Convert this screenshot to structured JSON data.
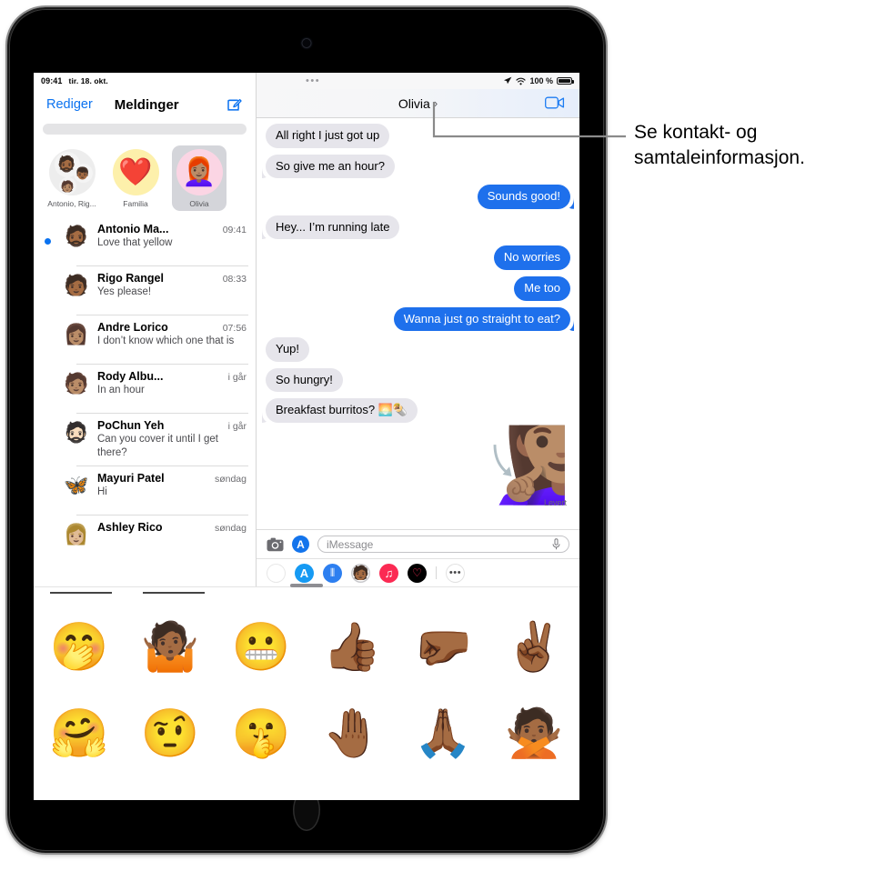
{
  "device": {
    "name": "iPad"
  },
  "status_bar": {
    "time": "09:41",
    "date": "tir. 18. okt.",
    "location_icon": "location-arrow-icon",
    "wifi_icon": "wifi-icon",
    "battery_percent": "100 %",
    "battery_icon": "battery-full-icon",
    "handle_dots": "•••"
  },
  "sidebar": {
    "edit_label": "Rediger",
    "title": "Meldinger",
    "compose_icon": "compose-icon",
    "search_placeholder": "",
    "pinned": [
      {
        "label": "Antonio, Rig...",
        "kind": "group",
        "faces": [
          "🧔🏾",
          "👦🏾",
          "🧑🏽"
        ]
      },
      {
        "label": "Familia",
        "kind": "emoji",
        "glyph": "❤️"
      },
      {
        "label": "Olivia",
        "kind": "memoji",
        "glyph": "👩🏽‍🦰",
        "selected": true
      }
    ],
    "conversations": [
      {
        "name": "Antonio Ma...",
        "time": "09:41",
        "preview": "Love that yellow",
        "unread": true,
        "avatar": "🧔🏾"
      },
      {
        "name": "Rigo Rangel",
        "time": "08:33",
        "preview": "Yes please!",
        "unread": false,
        "avatar": "🧑🏾"
      },
      {
        "name": "Andre Lorico",
        "time": "07:56",
        "preview": "I don’t know which one that is",
        "unread": false,
        "avatar": "👩🏽"
      },
      {
        "name": "Rody Albu...",
        "time": "i går",
        "preview": "In an hour",
        "unread": false,
        "avatar": "🧑🏽"
      },
      {
        "name": "PoChun Yeh",
        "time": "i går",
        "preview": "Can you cover it until I get there?",
        "unread": false,
        "avatar": "🧔🏻"
      },
      {
        "name": "Mayuri Patel",
        "time": "søndag",
        "preview": "Hi",
        "unread": false,
        "avatar": "🦋"
      },
      {
        "name": "Ashley Rico",
        "time": "søndag",
        "preview": "",
        "unread": false,
        "avatar": "👩🏼"
      }
    ]
  },
  "chat": {
    "title": "Olivia",
    "title_chevron": "chevron-right-icon",
    "facetime_icon": "facetime-video-icon",
    "messages": [
      {
        "from": "them",
        "text": "All right I just got up"
      },
      {
        "from": "them",
        "text": "So give me an hour?",
        "tail": true
      },
      {
        "from": "me",
        "text": "Sounds good!",
        "tail": true
      },
      {
        "from": "them",
        "text": "Hey... I’m running late",
        "tail": true
      },
      {
        "from": "me",
        "text": "No worries"
      },
      {
        "from": "me",
        "text": "Me too"
      },
      {
        "from": "me",
        "text": "Wanna just go straight to eat?",
        "tail": true
      },
      {
        "from": "them",
        "text": "Yup!"
      },
      {
        "from": "them",
        "text": "So hungry!"
      },
      {
        "from": "them",
        "text": "Breakfast burritos? 🌅🌯",
        "tail": true
      }
    ],
    "sticker_message": {
      "glyph": "🧏🏽‍♀️",
      "status": "Levert"
    },
    "input": {
      "camera_icon": "camera-icon",
      "appstore_icon": "app-store-icon",
      "placeholder": "iMessage",
      "value": "",
      "mic_icon": "microphone-icon"
    },
    "app_drawer": [
      {
        "name": "photos-app-icon",
        "glyph": "❀"
      },
      {
        "name": "app-store-app-icon",
        "glyph": "A"
      },
      {
        "name": "audio-message-app-icon",
        "glyph": "⦀"
      },
      {
        "name": "memoji-stickers-app-icon",
        "glyph": "🧑🏾"
      },
      {
        "name": "apple-music-app-icon",
        "glyph": "♫"
      },
      {
        "name": "digital-touch-app-icon",
        "glyph": "♡"
      },
      {
        "name": "more-apps-icon",
        "glyph": "•••"
      }
    ]
  },
  "sticker_sheet": {
    "grabber": "sheet-grabber",
    "stickers": [
      "🤭",
      "🤷🏾",
      "😬",
      "👍🏾",
      "🤛🏾",
      "✌🏾",
      "🤗",
      "🤨",
      "🤫",
      "🤚🏾",
      "🙏🏾",
      "🙅🏾"
    ]
  },
  "callout": {
    "text": "Se kontakt- og samtaleinformasjon."
  },
  "colors": {
    "accent_blue": "#0a72f0",
    "bubble_me": "#1e70ec",
    "bubble_them": "#e6e5eb",
    "selected_pin": "#d4d5da"
  }
}
